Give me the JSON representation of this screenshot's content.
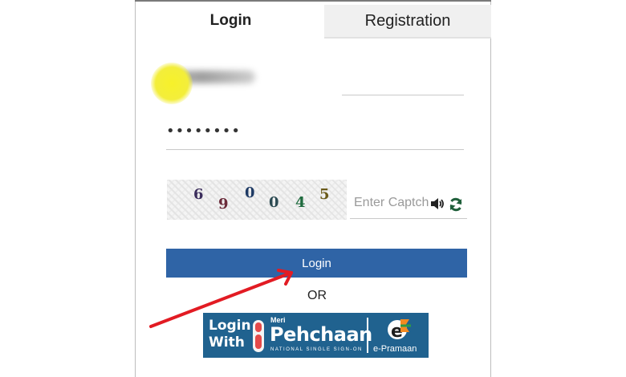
{
  "tabs": {
    "login": "Login",
    "registration": "Registration"
  },
  "form": {
    "password_mask": "••••••••",
    "captcha_digits": [
      "6",
      "9",
      "0",
      "0",
      "4",
      "5"
    ],
    "captcha_placeholder": "Enter Captcha",
    "login_button": "Login",
    "or_text": "OR"
  },
  "meri_pehchaan": {
    "line1": "Login",
    "line2": "With",
    "meri": "Meri",
    "name": "Pehchaan",
    "tagline": "NATIONAL SINGLE SIGN-ON",
    "epramaan": "e-Pramaan"
  },
  "icons": {
    "speaker": "speaker-icon",
    "refresh": "refresh-icon",
    "arrow": "red-annotation-arrow"
  },
  "colors": {
    "button": "#2f64a6",
    "pehchaan_bg": "#20628f",
    "arrow": "#e21b23",
    "highlight": "#f5ef2a"
  }
}
